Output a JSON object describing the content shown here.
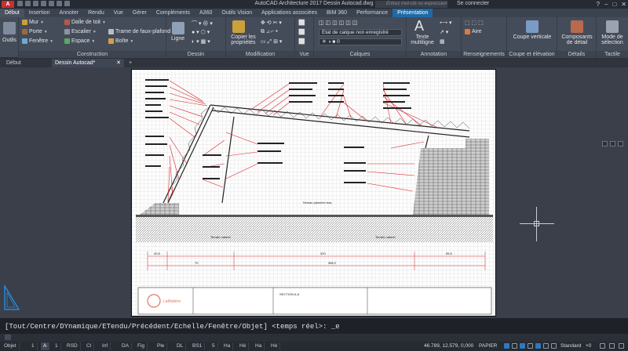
{
  "titlebar": {
    "app_logo": "A",
    "title": "AutoCAD Architecture 2017    Dessin Autocad.dwg",
    "search_placeholder": "Entrez mot-clé ou expression",
    "signin": "Se connecter",
    "help": "?"
  },
  "ribbon_tabs": [
    "Début",
    "Insertion",
    "Annoter",
    "Rendu",
    "Vue",
    "Gérer",
    "Compléments",
    "A360",
    "Outils Vision",
    "Applications associées",
    "BIM 360",
    "Performance",
    "Présentation"
  ],
  "active_tab": "Début",
  "panels": {
    "outils": {
      "label": "Outils"
    },
    "construction": {
      "title": "Construction",
      "col1": [
        "Mur",
        "Porte",
        "Fenêtre"
      ],
      "col2": [
        "Dalle de toit",
        "Escalier",
        "Espace"
      ],
      "col3": [
        "Trame de faux-plafond",
        "Boîte"
      ]
    },
    "dessin": {
      "title": "Dessin",
      "ligne": "Ligne"
    },
    "modification": {
      "title": "Modification",
      "copy_props": "Copier les propriétés"
    },
    "vue": {
      "title": "Vue"
    },
    "calques": {
      "title": "Calques",
      "layer_state": "État de calque non enregistré",
      "layer_current": "0"
    },
    "annotation": {
      "title": "Annotation",
      "text": "Texte multiligne"
    },
    "renseignements": {
      "title": "Renseignements",
      "aire": "Aire"
    },
    "coupe": {
      "title": "Coupe et élévation",
      "label": "Coupe verticale"
    },
    "details": {
      "title": "Détails",
      "label": "Composants de détail"
    },
    "tactile": {
      "title": "Tactile",
      "label": "Mode de sélection"
    }
  },
  "doc_tabs": [
    "Début",
    "Dessin Autocad*"
  ],
  "drawing": {
    "ground_left_label": "Terrain naturel",
    "ground_right_label": "Terrain naturel",
    "level_label": "Niveau plancher bas",
    "dims": [
      "20,8",
      "320",
      "55,5",
      "70",
      "386,2"
    ],
    "title_block_logo": "LaMatière",
    "title_block_section": "SECTION A-A"
  },
  "command": {
    "history": "[Tout/Centre/DYnamique/ETendu/Précédent/Echelle/Fenêtre/Objet] <temps réel>: _e"
  },
  "status": {
    "layout_tabs": [
      "Objet",
      "1",
      "A",
      "1",
      "RSD",
      "Cl",
      "Inf",
      "DA",
      "Fig",
      "Ple",
      "DL",
      "BS1",
      "5",
      "Ha",
      "Hé",
      "Ha",
      "Hé"
    ],
    "active_index": 2,
    "coords": "46.789, 12.579, 0,000",
    "paper": "PAPIER",
    "standard": "Standard",
    "scale": "+0"
  },
  "colors": {
    "ribbon_bg": "#454c59",
    "tab_active": "#1f6aa5",
    "leader_red": "#d9232c"
  }
}
